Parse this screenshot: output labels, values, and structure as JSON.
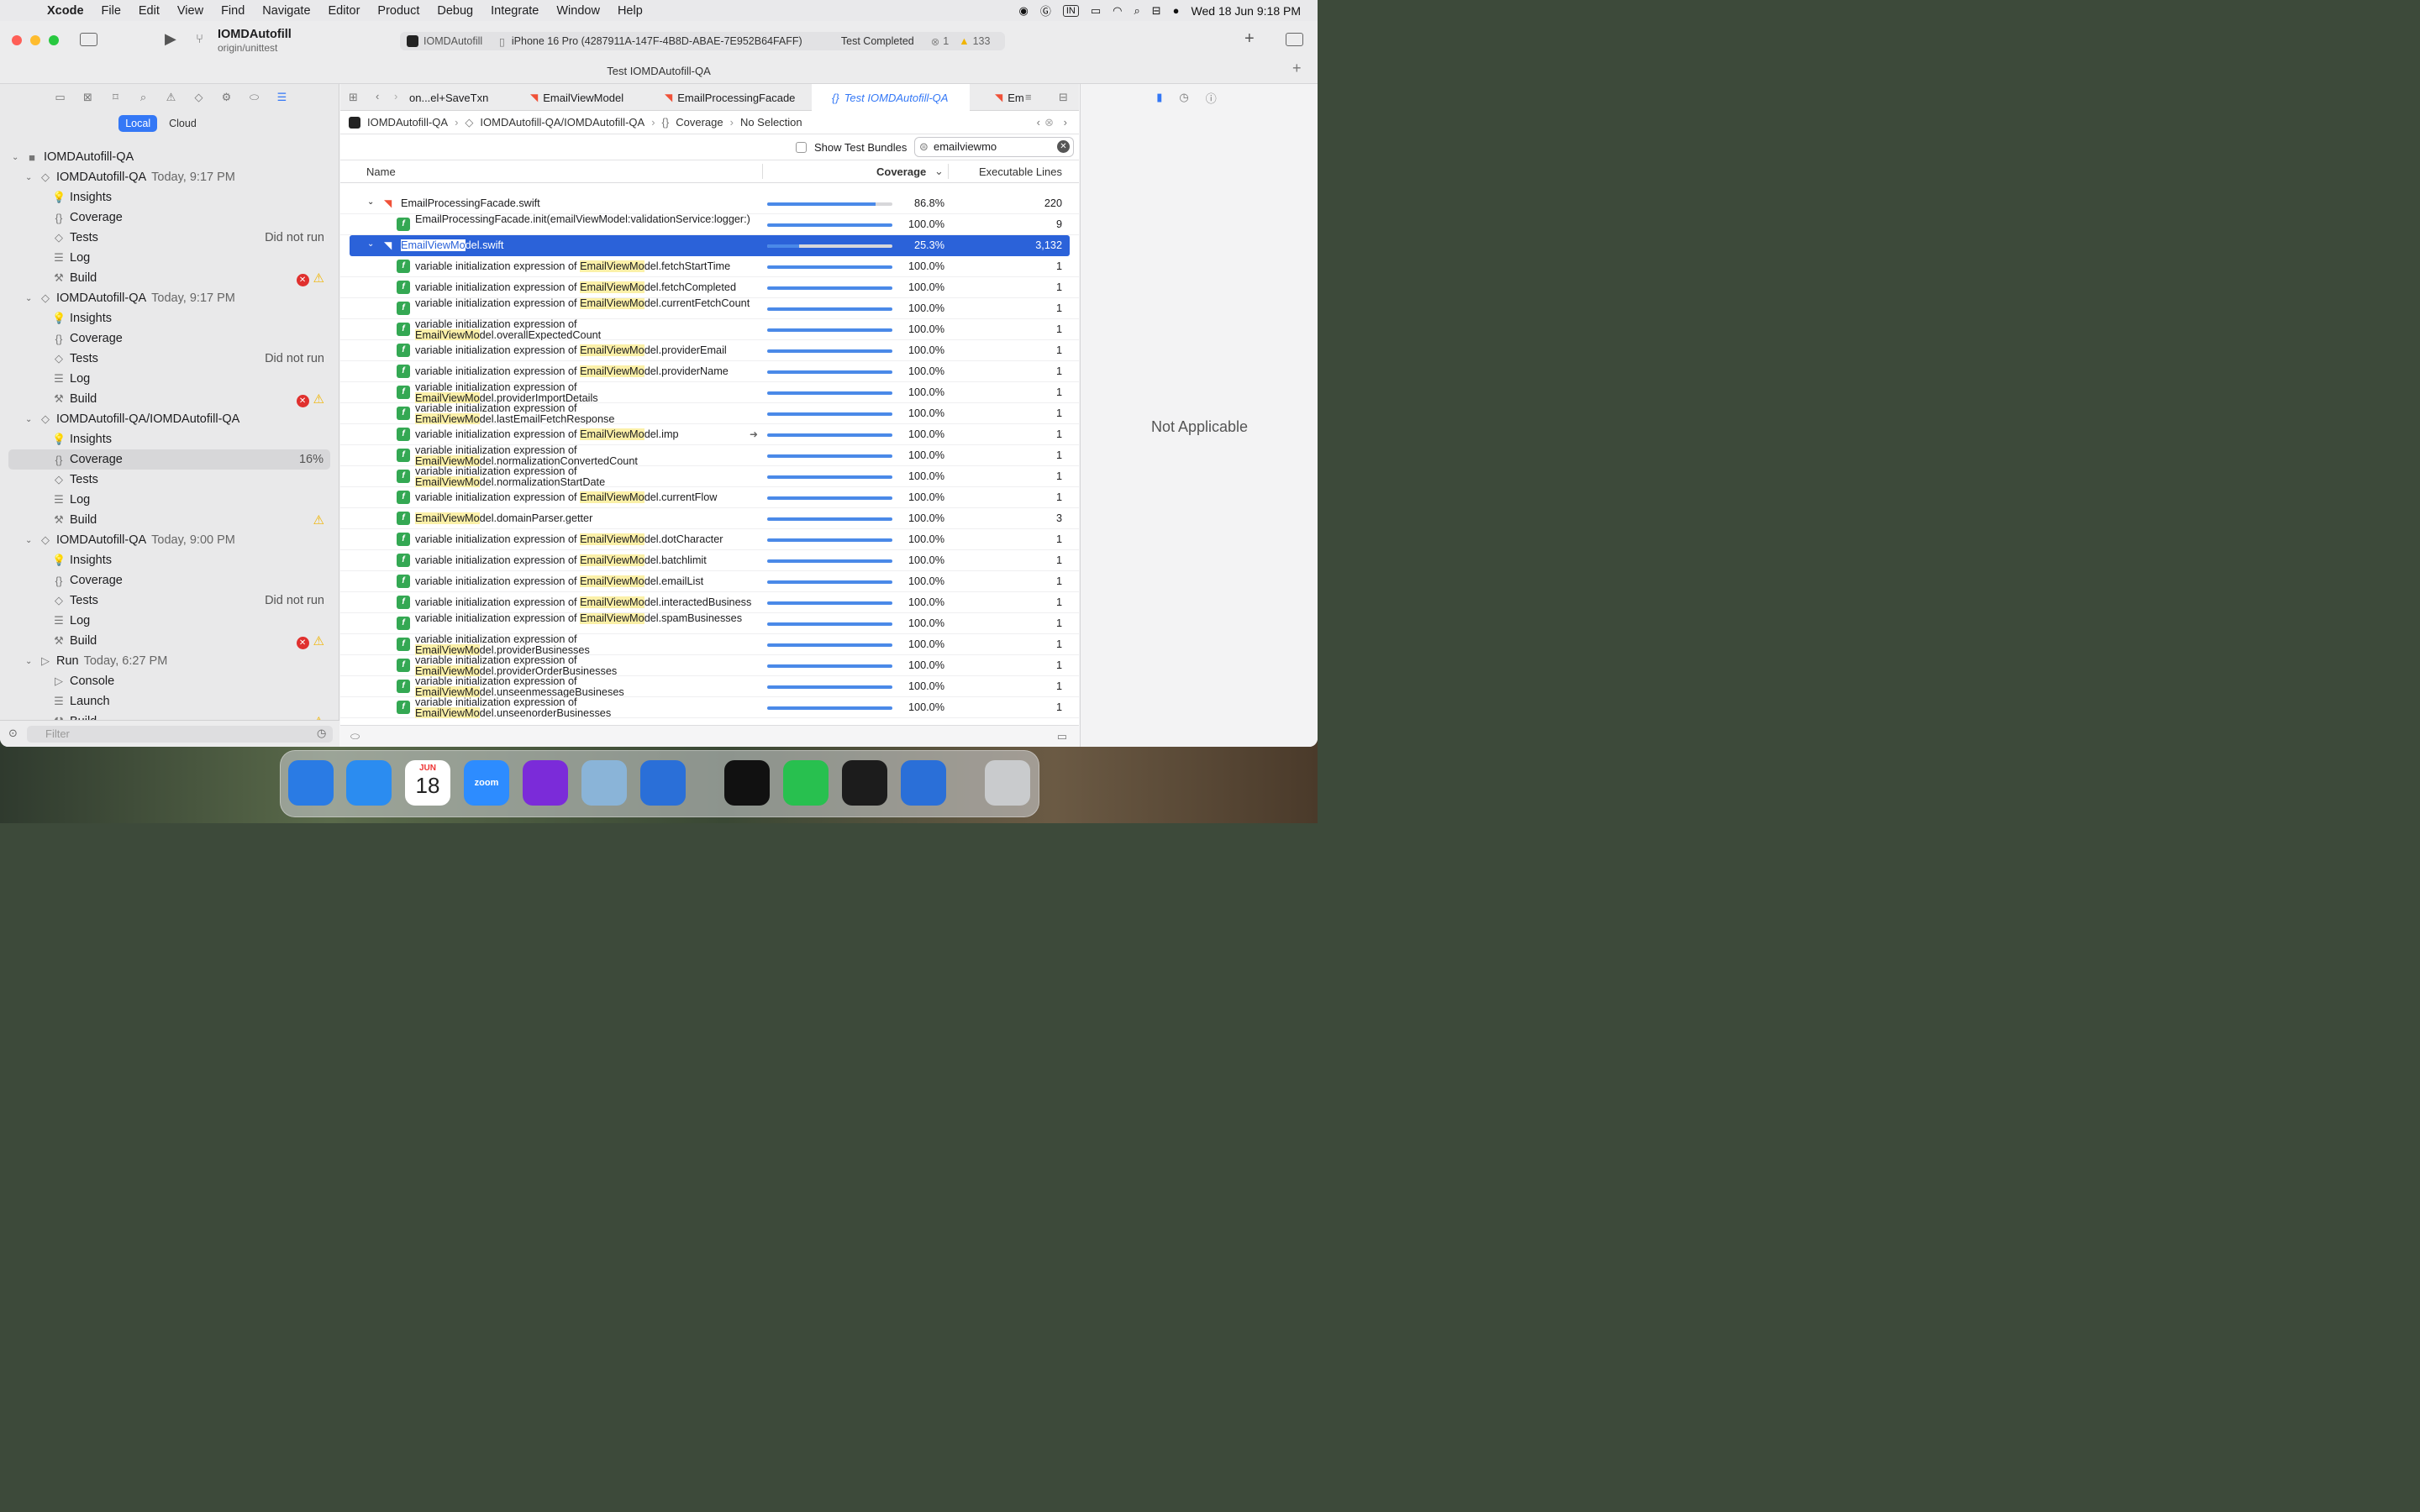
{
  "menubar": {
    "app": "Xcode",
    "items": [
      "File",
      "Edit",
      "View",
      "Find",
      "Navigate",
      "Editor",
      "Product",
      "Debug",
      "Integrate",
      "Window",
      "Help"
    ],
    "input_badge": "IN",
    "clock": "Wed 18 Jun  9:18 PM"
  },
  "toolbar": {
    "scheme": "IOMDAutofill",
    "branch": "origin/unittest",
    "target": "IOMDAutofill",
    "device": "iPhone 16 Pro (4287911A-147F-4B8D-ABAE-7E952B64FAFF)",
    "status": "Test Completed",
    "errors": "1",
    "warnings": "133",
    "window_title": "Test IOMDAutofill-QA"
  },
  "sidebar": {
    "seg_local": "Local",
    "seg_cloud": "Cloud",
    "filter_placeholder": "Filter",
    "rows": [
      {
        "label": "IOMDAutofill-QA",
        "level": 0
      },
      {
        "label": "IOMDAutofill-QA",
        "date": "Today, 9:17 PM",
        "level": 1
      },
      {
        "label": "Insights",
        "level": 2
      },
      {
        "label": "Coverage",
        "level": 2
      },
      {
        "label": "Tests",
        "right": "Did not run",
        "level": 2
      },
      {
        "label": "Log",
        "level": 2
      },
      {
        "label": "Build",
        "level": 2
      },
      {
        "label": "IOMDAutofill-QA",
        "date": "Today, 9:17 PM",
        "level": 1
      },
      {
        "label": "Insights",
        "level": 2
      },
      {
        "label": "Coverage",
        "level": 2
      },
      {
        "label": "Tests",
        "right": "Did not run",
        "level": 2
      },
      {
        "label": "Log",
        "level": 2
      },
      {
        "label": "Build",
        "level": 2
      },
      {
        "label": "IOMDAutofill-QA/IOMDAutofill-QA",
        "level": 1
      },
      {
        "label": "Insights",
        "level": 2
      },
      {
        "label": "Coverage",
        "right": "16%",
        "level": 2
      },
      {
        "label": "Tests",
        "level": 2
      },
      {
        "label": "Log",
        "level": 2
      },
      {
        "label": "Build",
        "level": 2
      },
      {
        "label": "IOMDAutofill-QA",
        "date": "Today, 9:00 PM",
        "level": 1
      },
      {
        "label": "Insights",
        "level": 2
      },
      {
        "label": "Coverage",
        "level": 2
      },
      {
        "label": "Tests",
        "right": "Did not run",
        "level": 2
      },
      {
        "label": "Log",
        "level": 2
      },
      {
        "label": "Build",
        "level": 2
      },
      {
        "label": "Run",
        "date": "Today, 6:27 PM",
        "level": 1
      },
      {
        "label": "Console",
        "level": 2
      },
      {
        "label": "Launch",
        "level": 2
      },
      {
        "label": "Build",
        "level": 2
      }
    ]
  },
  "tabs": [
    "on...el+SaveTxn",
    "EmailViewModel",
    "EmailProcessingFacade",
    "Test IOMDAutofill-QA",
    "Em"
  ],
  "jumpbar": [
    "IOMDAutofill-QA",
    "IOMDAutofill-QA/IOMDAutofill-QA",
    "Coverage",
    "No Selection"
  ],
  "options": {
    "show_bundles": "Show Test Bundles",
    "search_value": "emailviewmo"
  },
  "columns": {
    "name": "Name",
    "coverage": "Coverage",
    "lines": "Executable Lines"
  },
  "rows": [
    {
      "name": "EmailProcessingFacade.swift",
      "coverage": 0.868,
      "pct": "86.8%",
      "lines": "220",
      "kind": "file"
    },
    {
      "name": "EmailProcessingFacade.init(emailViewModel:validationService:logger:)",
      "coverage": 1.0,
      "pct": "100.0%",
      "lines": "9",
      "kind": "func"
    },
    {
      "name": "EmailViewModel.swift",
      "coverage": 0.253,
      "pct": "25.3%",
      "lines": "3,132",
      "kind": "file",
      "selected": true
    },
    {
      "name": "variable initialization expression of EmailViewModel.fetchStartTime",
      "coverage": 1.0,
      "pct": "100.0%",
      "lines": "1",
      "kind": "func"
    },
    {
      "name": "variable initialization expression of EmailViewModel.fetchCompleted",
      "coverage": 1.0,
      "pct": "100.0%",
      "lines": "1",
      "kind": "func"
    },
    {
      "name": "variable initialization expression of EmailViewModel.currentFetchCount",
      "coverage": 1.0,
      "pct": "100.0%",
      "lines": "1",
      "kind": "func"
    },
    {
      "name": "variable initialization expression of EmailViewModel.overallExpectedCount",
      "coverage": 1.0,
      "pct": "100.0%",
      "lines": "1",
      "kind": "func"
    },
    {
      "name": "variable initialization expression of EmailViewModel.providerEmail",
      "coverage": 1.0,
      "pct": "100.0%",
      "lines": "1",
      "kind": "func"
    },
    {
      "name": "variable initialization expression of EmailViewModel.providerName",
      "coverage": 1.0,
      "pct": "100.0%",
      "lines": "1",
      "kind": "func"
    },
    {
      "name": "variable initialization expression of EmailViewModel.providerImportDetails",
      "coverage": 1.0,
      "pct": "100.0%",
      "lines": "1",
      "kind": "func"
    },
    {
      "name": "variable initialization expression of EmailViewModel.lastEmailFetchResponse",
      "coverage": 1.0,
      "pct": "100.0%",
      "lines": "1",
      "kind": "func"
    },
    {
      "name": "variable initialization expression of EmailViewModel.imp",
      "coverage": 1.0,
      "pct": "100.0%",
      "lines": "1",
      "kind": "func"
    },
    {
      "name": "variable initialization expression of EmailViewModel.normalizationConvertedCount",
      "coverage": 1.0,
      "pct": "100.0%",
      "lines": "1",
      "kind": "func"
    },
    {
      "name": "variable initialization expression of EmailViewModel.normalizationStartDate",
      "coverage": 1.0,
      "pct": "100.0%",
      "lines": "1",
      "kind": "func"
    },
    {
      "name": "variable initialization expression of EmailViewModel.currentFlow",
      "coverage": 1.0,
      "pct": "100.0%",
      "lines": "1",
      "kind": "func"
    },
    {
      "name": "EmailViewModel.domainParser.getter",
      "coverage": 1.0,
      "pct": "100.0%",
      "lines": "3",
      "kind": "func"
    },
    {
      "name": "variable initialization expression of EmailViewModel.dotCharacter",
      "coverage": 1.0,
      "pct": "100.0%",
      "lines": "1",
      "kind": "func"
    },
    {
      "name": "variable initialization expression of EmailViewModel.batchlimit",
      "coverage": 1.0,
      "pct": "100.0%",
      "lines": "1",
      "kind": "func"
    },
    {
      "name": "variable initialization expression of EmailViewModel.emailList",
      "coverage": 1.0,
      "pct": "100.0%",
      "lines": "1",
      "kind": "func"
    },
    {
      "name": "variable initialization expression of EmailViewModel.interactedBusinesses",
      "coverage": 1.0,
      "pct": "100.0%",
      "lines": "1",
      "kind": "func"
    },
    {
      "name": "variable initialization expression of EmailViewModel.spamBusinesses",
      "coverage": 1.0,
      "pct": "100.0%",
      "lines": "1",
      "kind": "func"
    },
    {
      "name": "variable initialization expression of EmailViewModel.providerBusinesses",
      "coverage": 1.0,
      "pct": "100.0%",
      "lines": "1",
      "kind": "func"
    },
    {
      "name": "variable initialization expression of EmailViewModel.providerOrderBusinesses",
      "coverage": 1.0,
      "pct": "100.0%",
      "lines": "1",
      "kind": "func"
    },
    {
      "name": "variable initialization expression of EmailViewModel.unseenmessageBusineses",
      "coverage": 1.0,
      "pct": "100.0%",
      "lines": "1",
      "kind": "func"
    },
    {
      "name": "variable initialization expression of EmailViewModel.unseenorderBusinesses",
      "coverage": 1.0,
      "pct": "100.0%",
      "lines": "1",
      "kind": "func"
    }
  ],
  "inspector": {
    "text": "Not Applicable"
  },
  "dock": [
    {
      "name": "finder-icon",
      "color": "#2a7be4"
    },
    {
      "name": "safari-icon",
      "color": "#2b8cf0"
    },
    {
      "name": "calendar-icon",
      "color": "#ffffff",
      "month": "JUN",
      "day": "18"
    },
    {
      "name": "zoom-icon",
      "color": "#2d8cff",
      "label": "zoom"
    },
    {
      "name": "firefox-icon",
      "color": "#7b2bd9"
    },
    {
      "name": "preview-icon",
      "color": "#8ab4d8"
    },
    {
      "name": "xcode-icon",
      "color": "#2a6fd8"
    },
    {
      "name": "unity-icon",
      "color": "#111111"
    },
    {
      "name": "whatsapp-icon",
      "color": "#28c04f"
    },
    {
      "name": "terminal-icon",
      "color": "#1c1c1c"
    },
    {
      "name": "xcode-instruments-icon",
      "color": "#2a6fd8"
    },
    {
      "name": "trash-icon",
      "color": "#c9cbcd"
    }
  ]
}
